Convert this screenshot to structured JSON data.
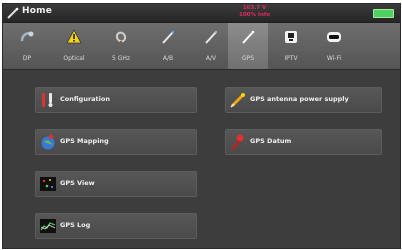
{
  "header": {
    "title": "Home",
    "status_line1": "163.7 V",
    "status_line2": "100% Info"
  },
  "toolbar": {
    "items": [
      {
        "label": "DP",
        "icon": "dp-icon"
      },
      {
        "label": "Optical",
        "icon": "optical-warning-icon"
      },
      {
        "label": "5 GHz",
        "icon": "satellite-dish-icon"
      },
      {
        "label": "A/B",
        "icon": "wand-icon"
      },
      {
        "label": "A/V",
        "icon": "wand-icon"
      },
      {
        "label": "GPS",
        "icon": "gps-wand-icon",
        "active": true
      },
      {
        "label": "IPTV",
        "icon": "iptv-icon"
      },
      {
        "label": "Wi-Fi",
        "icon": "wifi-icon"
      }
    ]
  },
  "menu": {
    "configuration": "Configuration",
    "gps_mapping": "GPS Mapping",
    "gps_view": "GPS View",
    "gps_log": "GPS Log",
    "gps_antenna": "GPS antenna power supply",
    "gps_datum": "GPS Datum"
  },
  "colors": {
    "accent_status": "#e02a5e",
    "battery": "#4fd060",
    "panel_bg": "#3d3d3d"
  }
}
